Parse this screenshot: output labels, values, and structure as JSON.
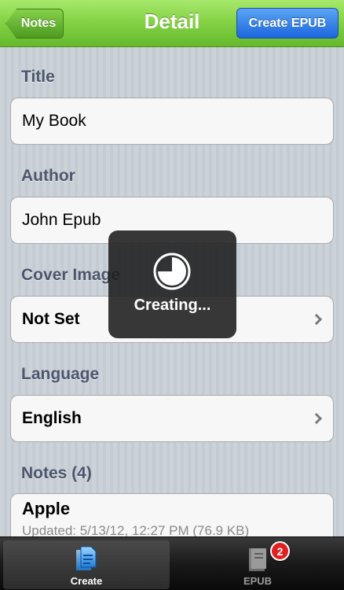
{
  "navbar": {
    "back_label": "Notes",
    "title": "Detail",
    "action_label": "Create EPUB"
  },
  "form": {
    "title_label": "Title",
    "title_value": "My Book",
    "author_label": "Author",
    "author_value": "John Epub",
    "cover_label": "Cover Image",
    "cover_value": "Not Set",
    "language_label": "Language",
    "language_value": "English"
  },
  "notes": {
    "label": "Notes (4)",
    "items": [
      {
        "title": "Apple",
        "subtitle": "Updated: 5/13/12, 12:27 PM (76.9 KB)"
      }
    ]
  },
  "hud": {
    "icon": "progress-pie-icon",
    "text": "Creating..."
  },
  "tabbar": {
    "tabs": [
      {
        "label": "Create",
        "icon": "document-icon",
        "selected": true
      },
      {
        "label": "EPUB",
        "icon": "book-icon",
        "badge": "2"
      }
    ]
  },
  "colors": {
    "navbar_green": "#86d347",
    "action_blue": "#1d66dd",
    "section_label": "#4c566c",
    "badge_red": "#e02020"
  }
}
